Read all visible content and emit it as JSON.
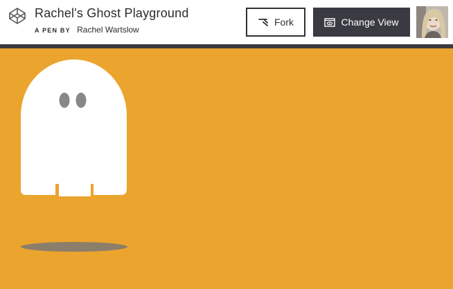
{
  "header": {
    "title": "Rachel's Ghost Playground",
    "byline_prefix": "A PEN BY",
    "author": "Rachel Wartslow",
    "fork_label": "Fork",
    "change_view_label": "Change View"
  },
  "icons": {
    "logo": "codepen-logo-icon",
    "fork": "fork-icon",
    "view": "eye-icon",
    "avatar": "user-avatar"
  },
  "colors": {
    "stage_background": "#eba42d",
    "ghost_body": "#ffffff",
    "ghost_eyes": "#888888",
    "dark_button": "#3a3a42",
    "header_bar": "#3a3a3f"
  }
}
